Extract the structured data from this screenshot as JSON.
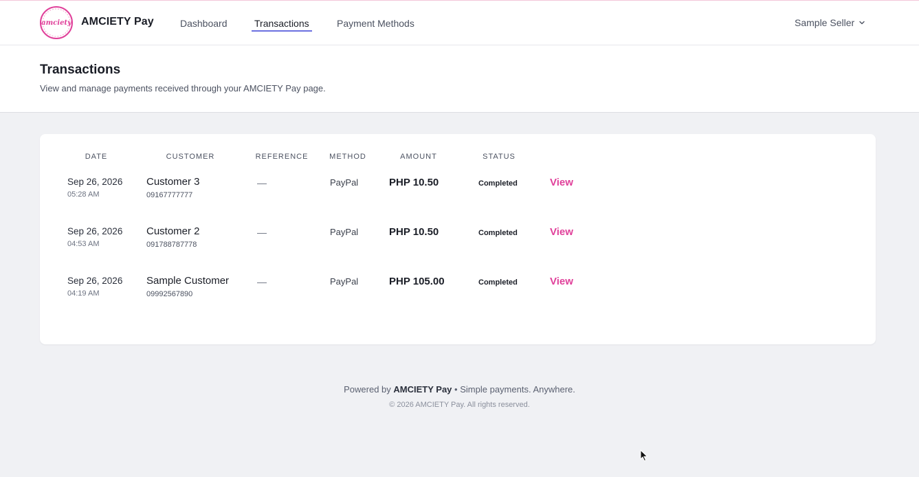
{
  "brand": {
    "name": "AMCIETY Pay",
    "logo_text": "amciety",
    "accent_color": "#e0409a"
  },
  "nav": {
    "items": [
      {
        "label": "Dashboard"
      },
      {
        "label": "Transactions",
        "active": true
      },
      {
        "label": "Payment Methods"
      }
    ],
    "user_label": "Sample Seller",
    "user_icon": "chevron-down-icon"
  },
  "header": {
    "title": "Transactions",
    "subtitle": "View and manage payments received through your AMCIETY Pay page."
  },
  "table": {
    "columns": [
      "DATE",
      "CUSTOMER",
      "REFERENCE",
      "METHOD",
      "AMOUNT",
      "STATUS"
    ],
    "rows": [
      {
        "date": "Sep 26, 2026",
        "time": "05:28 AM",
        "customer": "Customer 3",
        "phone": "09167777777",
        "reference": "—",
        "method": "PayPal",
        "amount": "PHP 10.50",
        "status": "Completed",
        "action": "View"
      },
      {
        "date": "Sep 26, 2026",
        "time": "04:53 AM",
        "customer": "Customer 2",
        "phone": "091788787778",
        "reference": "—",
        "method": "PayPal",
        "amount": "PHP 10.50",
        "status": "Completed",
        "action": "View"
      },
      {
        "date": "Sep 26, 2026",
        "time": "04:19 AM",
        "customer": "Sample Customer",
        "phone": "09992567890",
        "reference": "—",
        "method": "PayPal",
        "amount": "PHP 105.00",
        "status": "Completed",
        "action": "View"
      }
    ]
  },
  "footer": {
    "powered_prefix": "Powered by",
    "powered_brand": "AMCIETY Pay",
    "separator": "•",
    "tagline": "Simple payments. Anywhere.",
    "copyright": "© 2026 AMCIETY Pay. All rights reserved."
  }
}
